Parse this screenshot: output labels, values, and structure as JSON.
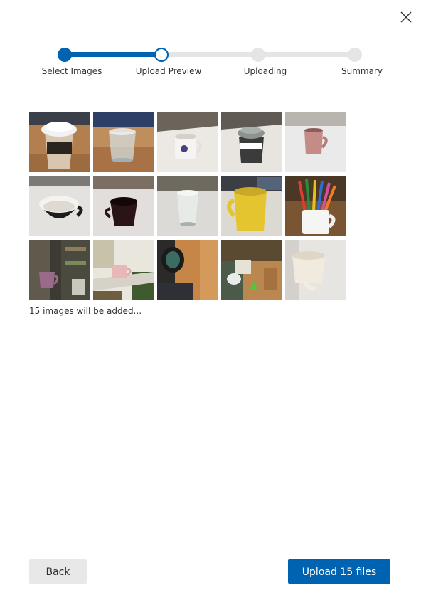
{
  "dialog": {
    "close_icon": "close-icon"
  },
  "stepper": {
    "steps": [
      {
        "label": "Select Images",
        "state": "done"
      },
      {
        "label": "Upload Preview",
        "state": "current"
      },
      {
        "label": "Uploading",
        "state": "todo"
      },
      {
        "label": "Summary",
        "state": "todo"
      }
    ],
    "accent_color": "#0063b1",
    "inactive_color": "#e5e5e5"
  },
  "preview": {
    "images": [
      {
        "subject": "paper-coffee-cup-photo"
      },
      {
        "subject": "glass-photo"
      },
      {
        "subject": "white-mug-photo"
      },
      {
        "subject": "travel-mug-photo"
      },
      {
        "subject": "pink-mug-photo"
      },
      {
        "subject": "black-white-cup-photo"
      },
      {
        "subject": "dark-red-cup-photo"
      },
      {
        "subject": "glass-photo"
      },
      {
        "subject": "yellow-mug-photo"
      },
      {
        "subject": "pencil-mug-photo"
      },
      {
        "subject": "hanging-mug-photo"
      },
      {
        "subject": "pink-cup-on-shelf-photo"
      },
      {
        "subject": "black-cup-photo"
      },
      {
        "subject": "cups-on-table-photo"
      },
      {
        "subject": "white-mug-photo"
      }
    ],
    "count_text": "15 images will be added..."
  },
  "footer": {
    "back_label": "Back",
    "upload_label": "Upload 15 files"
  }
}
